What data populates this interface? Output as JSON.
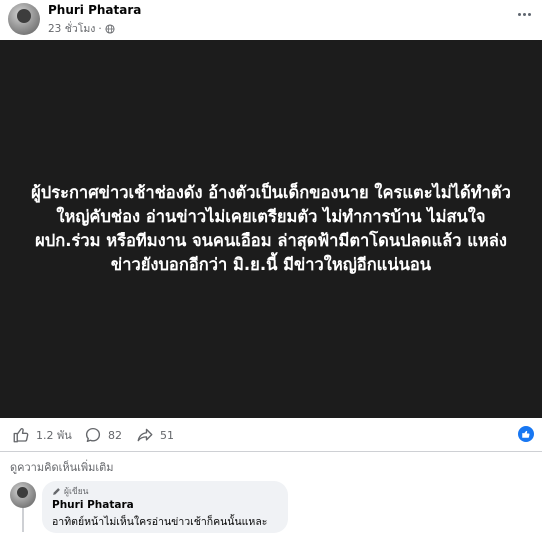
{
  "post": {
    "author": "Phuri Phatara",
    "timestamp": "23 ชั่วโมง",
    "separator": "·",
    "privacy_icon": "globe-icon",
    "more_icon": "more-options-icon",
    "image_text": "ผู้ประกาศข่าวเช้าช่องดัง อ้างตัวเป็นเด็กของนาย ใครแตะไม่ได้ทำตัวใหญ่คับช่อง อ่านข่าวไม่เคยเตรียมตัว ไม่ทำการบ้าน ไม่สนใจ ผปก.ร่วม หรือทีมงาน จนคนเอือม ล่าสุดฟ้ามีตาโดนปลดแล้ว แหล่งข่าวยังบอกอีกว่า มิ.ย.นี้ มีข่าวใหญ่อีกแน่นอน",
    "image_background": "#1c1c1c"
  },
  "actions": {
    "likes": "1.2 พัน",
    "comments": "82",
    "shares": "51"
  },
  "view_more_comments": "ดูความคิดเห็นเพิ่มเติม",
  "comment": {
    "badge": "ผู้เขียน",
    "author": "Phuri Phatara",
    "text": "อาทิตย์หน้าไม่เห็นใครอ่านข่าวเช้าก็คนนั้นแหละ"
  },
  "colors": {
    "accent": "#1877f2",
    "secondary_text": "#65676b",
    "bubble_bg": "#f0f2f5"
  }
}
